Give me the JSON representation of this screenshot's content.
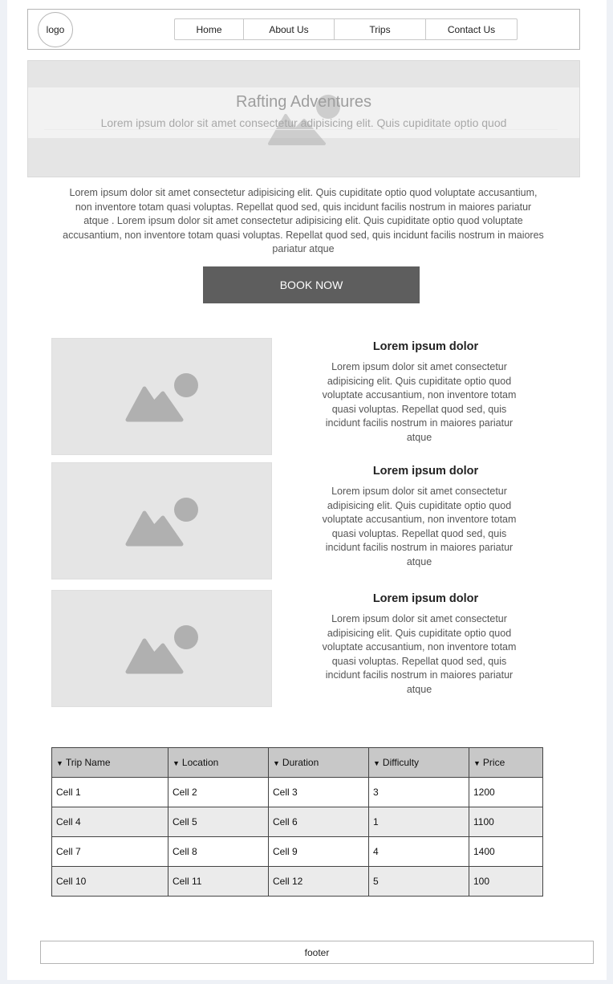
{
  "header": {
    "logo": "logo",
    "nav": [
      "Home",
      "About Us",
      "Trips",
      "Contact Us"
    ]
  },
  "hero": {
    "title": "Rafting Adventures",
    "subtitle": "Lorem ipsum dolor sit amet consectetur adipisicing elit. Quis cupiditate optio quod"
  },
  "intro": "Lorem ipsum dolor sit amet consectetur adipisicing elit. Quis cupiditate optio quod voluptate accusantium, non inventore totam quasi voluptas. Repellat quod sed, quis incidunt facilis nostrum in maiores pariatur atque . Lorem ipsum dolor sit amet consectetur adipisicing elit. Quis cupiditate optio quod voluptate accusantium, non inventore totam quasi voluptas. Repellat quod sed, quis incidunt facilis nostrum in maiores pariatur atque",
  "book_button": "BOOK NOW",
  "features": [
    {
      "title": "Lorem ipsum dolor",
      "body": "Lorem ipsum dolor sit amet consectetur adipisicing elit. Quis cupiditate optio quod voluptate accusantium, non inventore totam quasi voluptas. Repellat quod sed, quis incidunt facilis nostrum in maiores pariatur atque"
    },
    {
      "title": "Lorem ipsum dolor",
      "body": "Lorem ipsum dolor sit amet consectetur adipisicing elit. Quis cupiditate optio quod voluptate accusantium, non inventore totam quasi voluptas. Repellat quod sed, quis incidunt facilis nostrum in maiores pariatur atque"
    },
    {
      "title": "Lorem ipsum dolor",
      "body": "Lorem ipsum dolor sit amet consectetur adipisicing elit. Quis cupiditate optio quod voluptate accusantium, non inventore totam quasi voluptas. Repellat quod sed, quis incidunt facilis nostrum in maiores pariatur atque"
    }
  ],
  "table": {
    "headers": [
      "Trip Name",
      "Location",
      "Duration",
      "Difficulty",
      "Price"
    ],
    "rows": [
      [
        "Cell 1",
        "Cell 2",
        "Cell 3",
        "3",
        "1200"
      ],
      [
        "Cell 4",
        "Cell 5",
        "Cell 6",
        "1",
        "1100"
      ],
      [
        "Cell 7",
        "Cell 8",
        "Cell 9",
        "4",
        "1400"
      ],
      [
        "Cell 10",
        "Cell 11",
        "Cell 12",
        "5",
        "100"
      ]
    ]
  },
  "footer": "footer"
}
